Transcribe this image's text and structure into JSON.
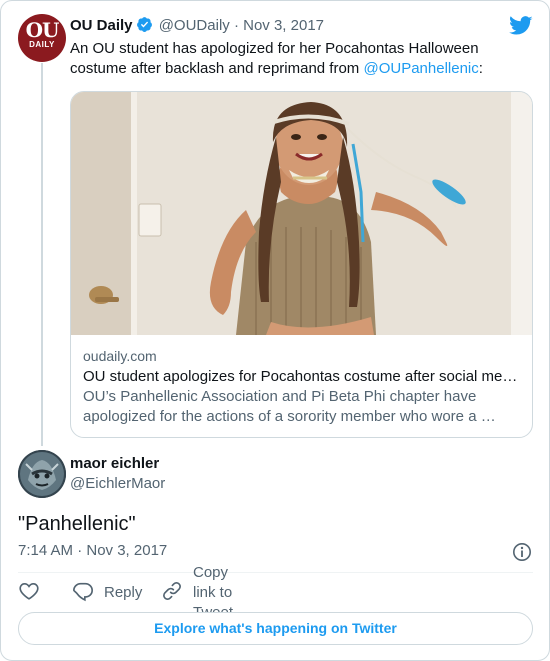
{
  "colors": {
    "accent": "#1d9bf0",
    "text": "#0f1419",
    "secondary": "#536471",
    "border": "#cfd9de",
    "ou_red": "#8b1a1f"
  },
  "quoted_tweet": {
    "avatar_text_top": "OU",
    "avatar_text_bottom": "DAILY",
    "display_name": "OU Daily",
    "handle": "@OUDaily",
    "separator": "·",
    "date": "Nov 3, 2017",
    "text_before_link": "An OU student has apologized for her Pocahontas Halloween costume after backlash and reprimand from ",
    "mention": "@OUPanhellenic",
    "text_after_link": ":",
    "link_card": {
      "domain": "oudaily.com",
      "title": "OU student apologizes for Pocahontas costume after social me…",
      "description": "OU’s Panhellenic Association and Pi Beta Phi chapter have apologized for the actions of a sorority member who wore a …"
    }
  },
  "main_tweet": {
    "display_name": "maor eichler",
    "handle": "@EichlerMaor",
    "text": "\"Panhellenic\"",
    "timestamp": "7:14 AM · Nov 3, 2017"
  },
  "actions": {
    "reply_label": "Reply",
    "copy_label": "Copy link to Tweet"
  },
  "explore_label": "Explore what's happening on Twitter",
  "icons": [
    "verified-badge-icon",
    "twitter-bird-icon",
    "info-icon",
    "heart-icon",
    "reply-icon",
    "link-icon"
  ]
}
